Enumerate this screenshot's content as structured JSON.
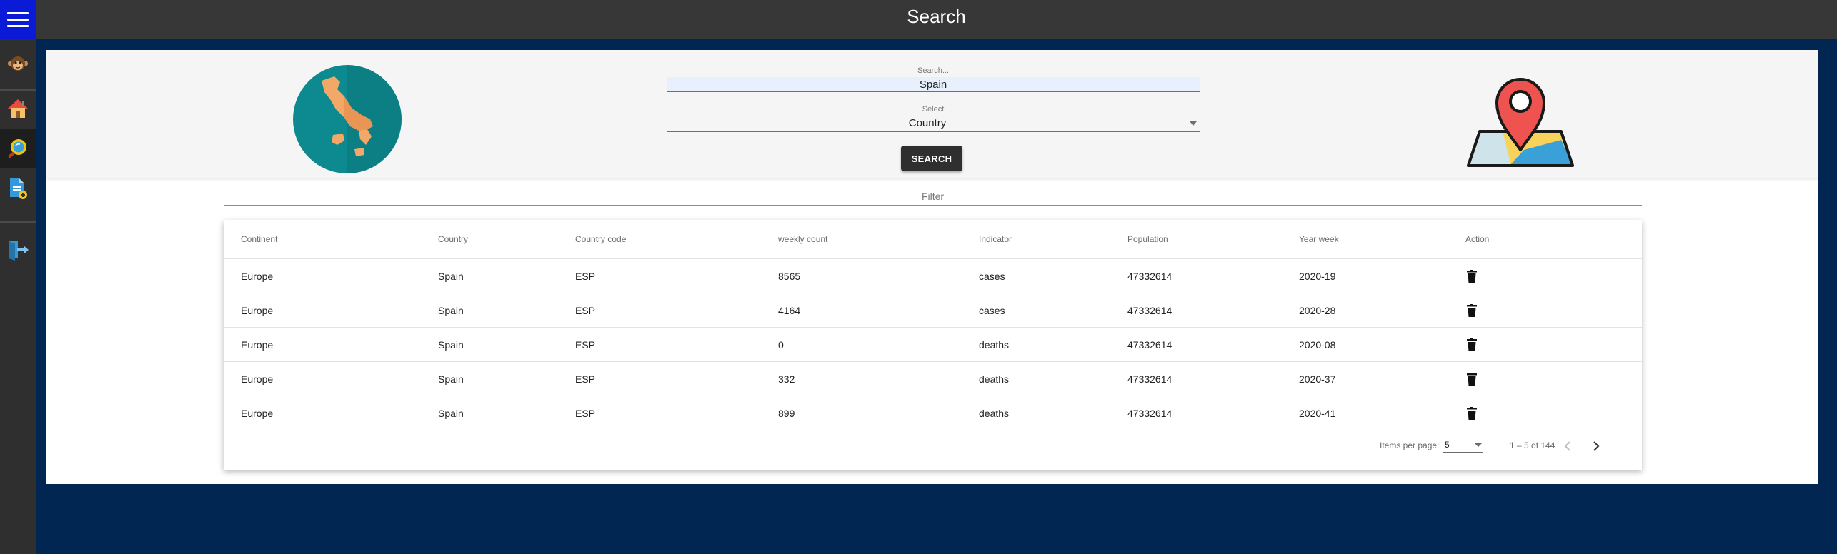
{
  "header": {
    "title": "Search"
  },
  "sidebar": {
    "items": [
      {
        "icon": "hamburger-menu-icon"
      },
      {
        "icon": "monkey-avatar-icon"
      },
      {
        "icon": "home-icon"
      },
      {
        "icon": "search-icon"
      },
      {
        "icon": "add-document-icon"
      },
      {
        "icon": "logout-icon"
      }
    ]
  },
  "search": {
    "label": "Search...",
    "value": "Spain",
    "select_label": "Select",
    "select_value": "Country",
    "button_label": "SEARCH"
  },
  "filter": {
    "placeholder": "Filter"
  },
  "table": {
    "columns": [
      "Continent",
      "Country",
      "Country code",
      "weekly count",
      "Indicator",
      "Population",
      "Year week",
      "Action"
    ],
    "rows": [
      [
        "Europe",
        "Spain",
        "ESP",
        "8565",
        "cases",
        "47332614",
        "2020-19"
      ],
      [
        "Europe",
        "Spain",
        "ESP",
        "4164",
        "cases",
        "47332614",
        "2020-28"
      ],
      [
        "Europe",
        "Spain",
        "ESP",
        "0",
        "deaths",
        "47332614",
        "2020-08"
      ],
      [
        "Europe",
        "Spain",
        "ESP",
        "332",
        "deaths",
        "47332614",
        "2020-37"
      ],
      [
        "Europe",
        "Spain",
        "ESP",
        "899",
        "deaths",
        "47332614",
        "2020-41"
      ]
    ]
  },
  "paginator": {
    "items_per_page_label": "Items per page:",
    "page_size": "5",
    "range_label": "1 – 5 of 144"
  },
  "colors": {
    "sidebar_bg": "#2f2f2f",
    "menu_button_bg": "#0a1ad6",
    "topbar_bg": "#373737",
    "page_bg": "#002651",
    "button_bg": "#2f2f2f"
  }
}
